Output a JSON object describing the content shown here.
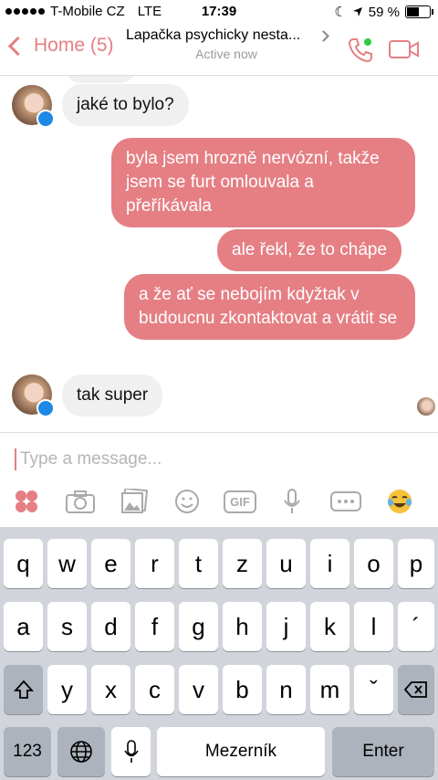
{
  "status": {
    "carrier": "T-Mobile CZ",
    "network": "LTE",
    "time": "17:39",
    "battery": "59 %",
    "battery_level": 0.59
  },
  "nav": {
    "back_label": "Home (5)",
    "title": "Lapačka psychicky nesta...",
    "subtitle": "Active now"
  },
  "messages": {
    "m1": "jaké to bylo?",
    "m2": "byla jsem hrozně nervózní, takže jsem se furt omlouvala a přeříkávala",
    "m3": "ale řekl, že to chápe",
    "m4": "a že ať se nebojím kdyžtak v budoucnu zkontaktovat a vrátit se",
    "m5": "tak super"
  },
  "composer": {
    "placeholder": "Type a message...",
    "gif_label": "GIF"
  },
  "keyboard": {
    "row1": [
      "q",
      "w",
      "e",
      "r",
      "t",
      "z",
      "u",
      "i",
      "o",
      "p"
    ],
    "row2": [
      "a",
      "s",
      "d",
      "f",
      "g",
      "h",
      "j",
      "k",
      "l",
      "´"
    ],
    "row3": [
      "y",
      "x",
      "c",
      "v",
      "b",
      "n",
      "m",
      "ˇ"
    ],
    "numbers_label": "123",
    "space_label": "Mezerník",
    "enter_label": "Enter"
  },
  "colors": {
    "accent": "#e57f84",
    "incoming_bubble": "#f1f0f0",
    "online": "#2ecc40"
  }
}
